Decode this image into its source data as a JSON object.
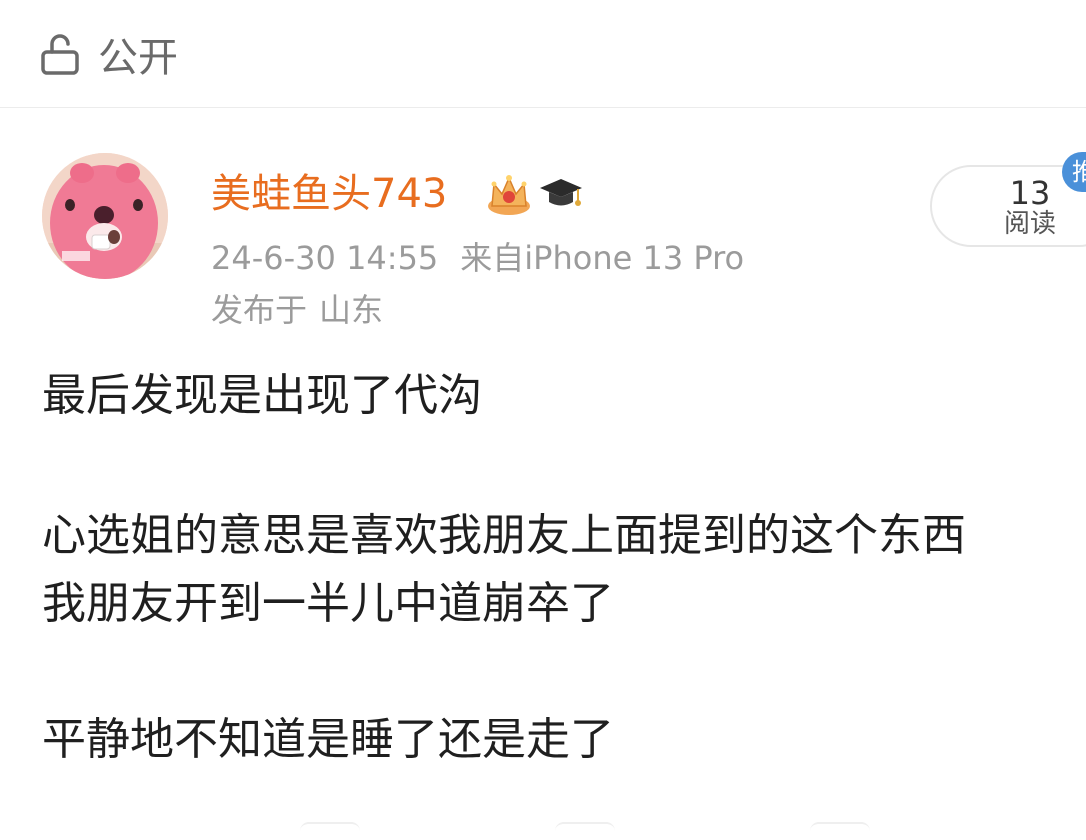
{
  "header": {
    "visibility_icon": "lock-open-icon",
    "visibility_label": "公开"
  },
  "author": {
    "avatar_icon": "pink-beaver-avatar",
    "name": "美蛙鱼头743",
    "badges": [
      "crown-icon",
      "graduation-cap-icon"
    ],
    "name_color": "#e86d1f"
  },
  "post_meta": {
    "timestamp": "24-6-30 14:55",
    "source": "来自iPhone 13 Pro",
    "location_prefix": "发布于",
    "location": "山东"
  },
  "read_stats": {
    "count": "13",
    "label": "阅读",
    "badge": "推"
  },
  "post": {
    "lines": [
      "最后发现是出现了代沟",
      "心选姐的意思是喜欢我朋友上面提到的这个东西",
      "我朋友开到一半儿中道崩卒了",
      "平静地不知道是睡了还是走了"
    ]
  }
}
